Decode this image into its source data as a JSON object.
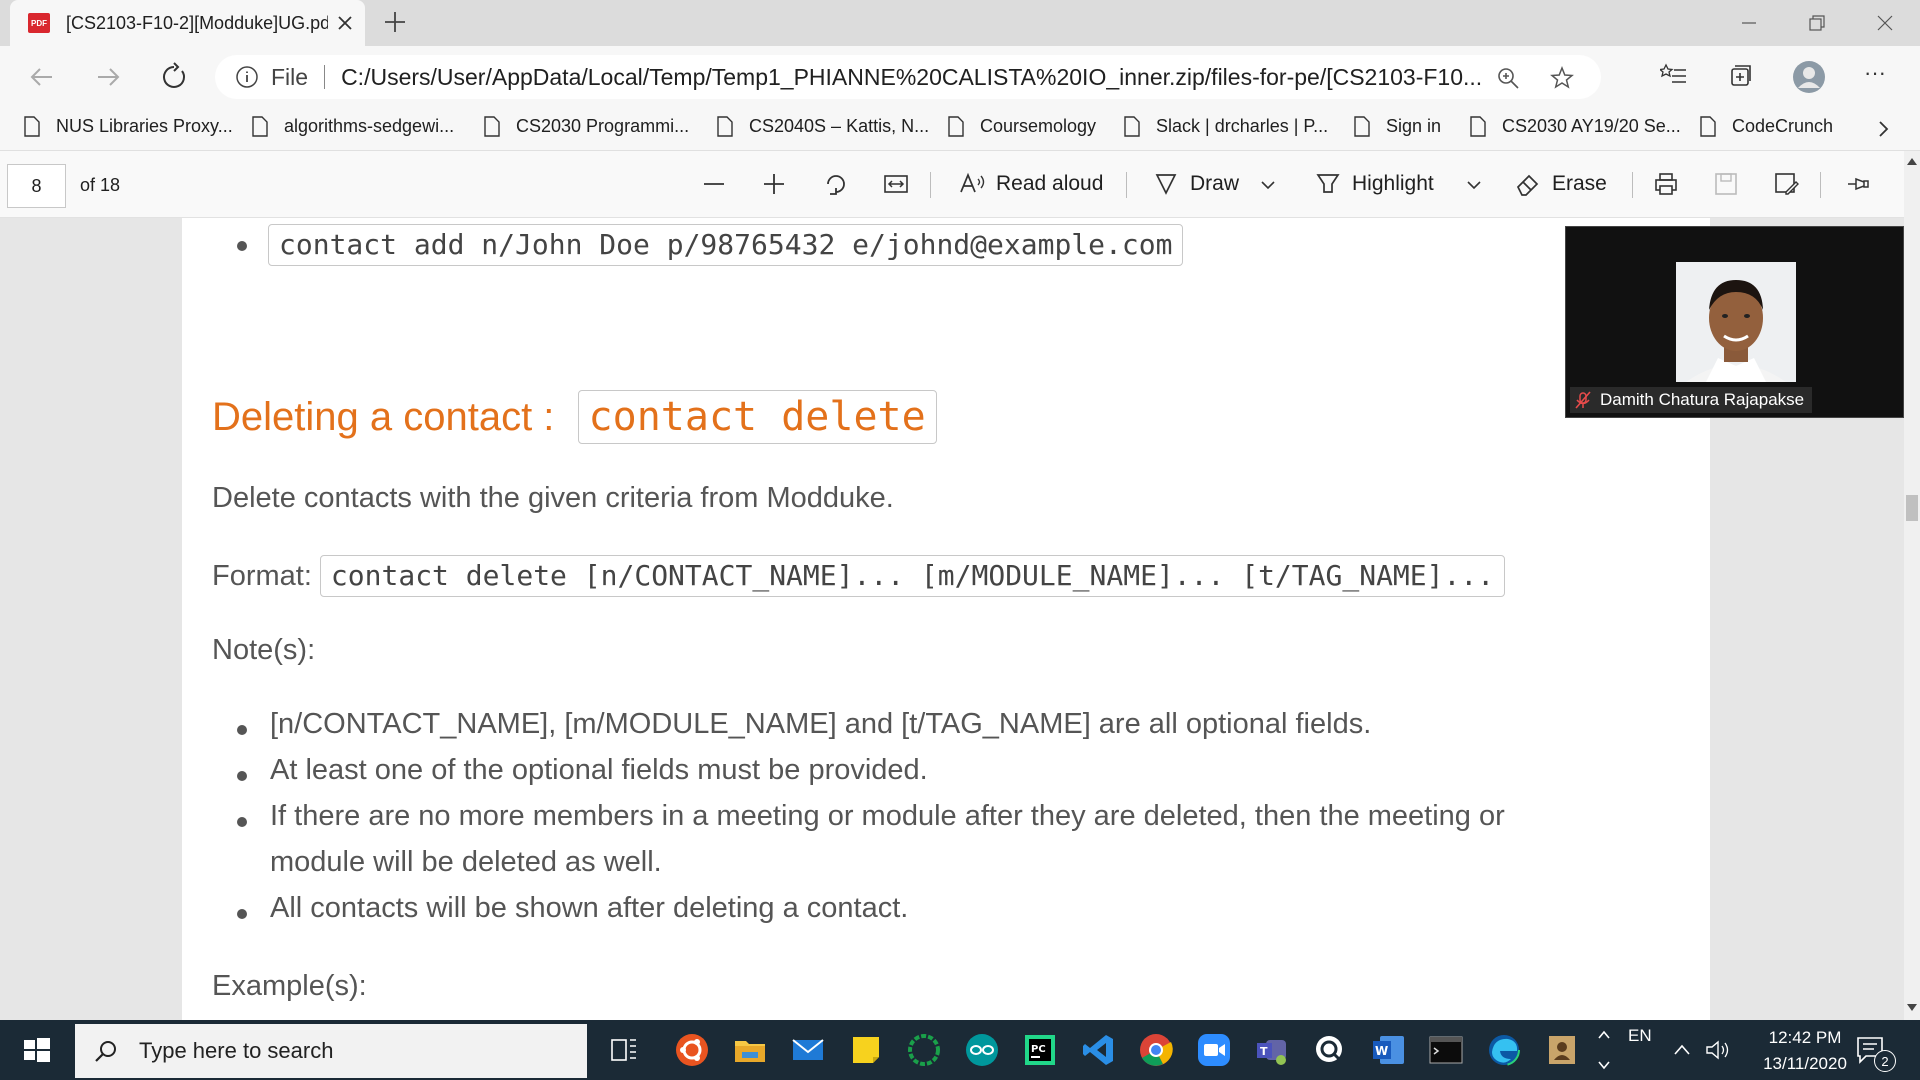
{
  "browser": {
    "tab_title": "[CS2103-F10-2][Modduke]UG.pdf",
    "tab_icon_text": "PDF",
    "address_scheme": "File",
    "address_url": "C:/Users/User/AppData/Local/Temp/Temp1_PHIANNE%20CALISTA%20IO_inner.zip/files-for-pe/[CS2103-F10...",
    "more_label": "···"
  },
  "favorites": [
    "NUS Libraries Proxy...",
    "algorithms-sedgewi...",
    "CS2030 Programmi...",
    "CS2040S – Kattis, N...",
    "Coursemology",
    "Slack | drcharles | P...",
    "Sign in",
    "CS2030 AY19/20 Se...",
    "CodeCrunch"
  ],
  "pdf_toolbar": {
    "page_number": "8",
    "page_total": "of 18",
    "read_aloud": "Read aloud",
    "draw": "Draw",
    "highlight": "Highlight",
    "erase": "Erase"
  },
  "document": {
    "example_command": "contact add n/John Doe p/98765432 e/johnd@example.com",
    "heading_text": "Deleting a contact : ",
    "heading_code": "contact delete",
    "description": "Delete contacts with the given criteria from Modduke.",
    "format_label": "Format:",
    "format_code": "contact delete [n/CONTACT_NAME]... [m/MODULE_NAME]... [t/TAG_NAME]...",
    "notes_label": "Note(s):",
    "notes": [
      "[n/CONTACT_NAME], [m/MODULE_NAME] and [t/TAG_NAME] are all optional fields.",
      "At least one of the optional fields must be provided.",
      "If there are no more members in a meeting or module after they are deleted, then the meeting or",
      "module will be deleted as well.",
      "All contacts will be shown after deleting a contact."
    ],
    "examples_label": "Example(s):"
  },
  "video_call": {
    "participant_name": "Damith Chatura Rajapakse"
  },
  "taskbar": {
    "search_placeholder": "Type here to search",
    "language": "EN",
    "time": "12:42 PM",
    "date": "13/11/2020",
    "notification_count": "2"
  },
  "colors": {
    "heading_orange": "#e3711b",
    "body_text": "#555555",
    "taskbar_bg": "#1b2a36"
  }
}
